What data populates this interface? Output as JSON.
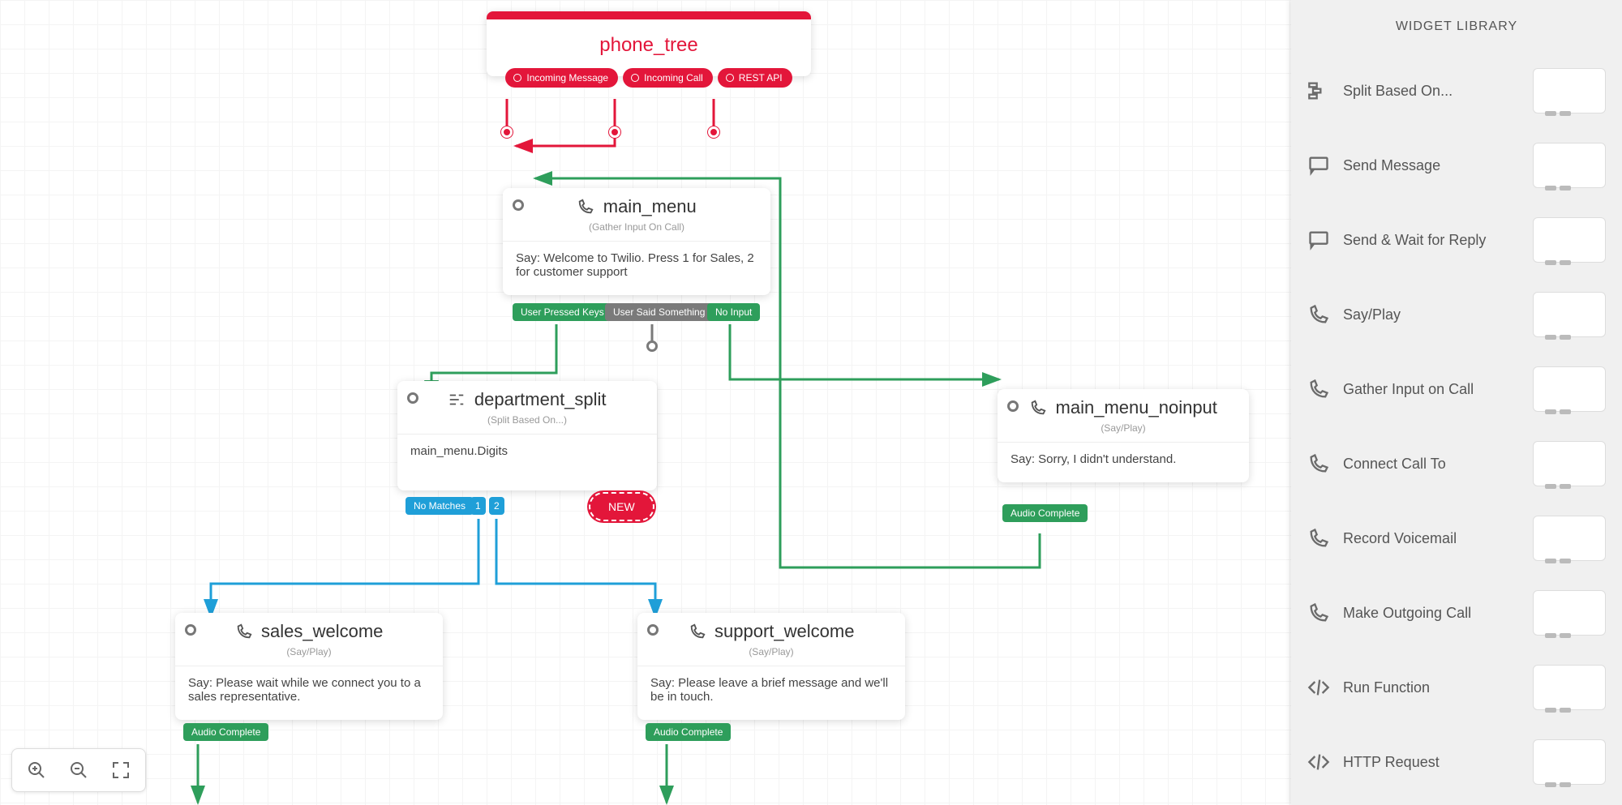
{
  "trigger": {
    "title": "phone_tree",
    "pills": [
      "Incoming Message",
      "Incoming Call",
      "REST API"
    ]
  },
  "nodes": {
    "main_menu": {
      "title": "main_menu",
      "subtitle": "(Gather Input On Call)",
      "body": "Say: Welcome to Twilio. Press 1 for Sales, 2 for customer support",
      "outs": {
        "a": "User Pressed Keys",
        "b": "User Said Something",
        "c": "No Input"
      }
    },
    "department_split": {
      "title": "department_split",
      "subtitle": "(Split Based On...)",
      "body": "main_menu.Digits",
      "outs": {
        "nomatch": "No Matches",
        "one": "1",
        "two": "2"
      },
      "new": "NEW"
    },
    "noinput": {
      "title": "main_menu_noinput",
      "subtitle": "(Say/Play)",
      "body": "Say: Sorry, I didn't understand.",
      "outs": {
        "done": "Audio Complete"
      }
    },
    "sales": {
      "title": "sales_welcome",
      "subtitle": "(Say/Play)",
      "body": "Say: Please wait while we connect you to a sales representative.",
      "outs": {
        "done": "Audio Complete"
      }
    },
    "support": {
      "title": "support_welcome",
      "subtitle": "(Say/Play)",
      "body": "Say: Please leave a brief message and we'll be in touch.",
      "outs": {
        "done": "Audio Complete"
      }
    }
  },
  "library": {
    "title": "WIDGET LIBRARY",
    "items": [
      {
        "icon": "split",
        "label": "Split Based On..."
      },
      {
        "icon": "msg",
        "label": "Send Message"
      },
      {
        "icon": "msg",
        "label": "Send & Wait for Reply"
      },
      {
        "icon": "phone",
        "label": "Say/Play"
      },
      {
        "icon": "phone",
        "label": "Gather Input on Call"
      },
      {
        "icon": "phone",
        "label": "Connect Call To"
      },
      {
        "icon": "phone",
        "label": "Record Voicemail"
      },
      {
        "icon": "phone",
        "label": "Make Outgoing Call"
      },
      {
        "icon": "code",
        "label": "Run Function"
      },
      {
        "icon": "code",
        "label": "HTTP Request"
      }
    ]
  },
  "colors": {
    "red": "#e3163a",
    "green": "#2e9e5b",
    "blue": "#1f9fd8",
    "gray": "#7a7a7a"
  }
}
